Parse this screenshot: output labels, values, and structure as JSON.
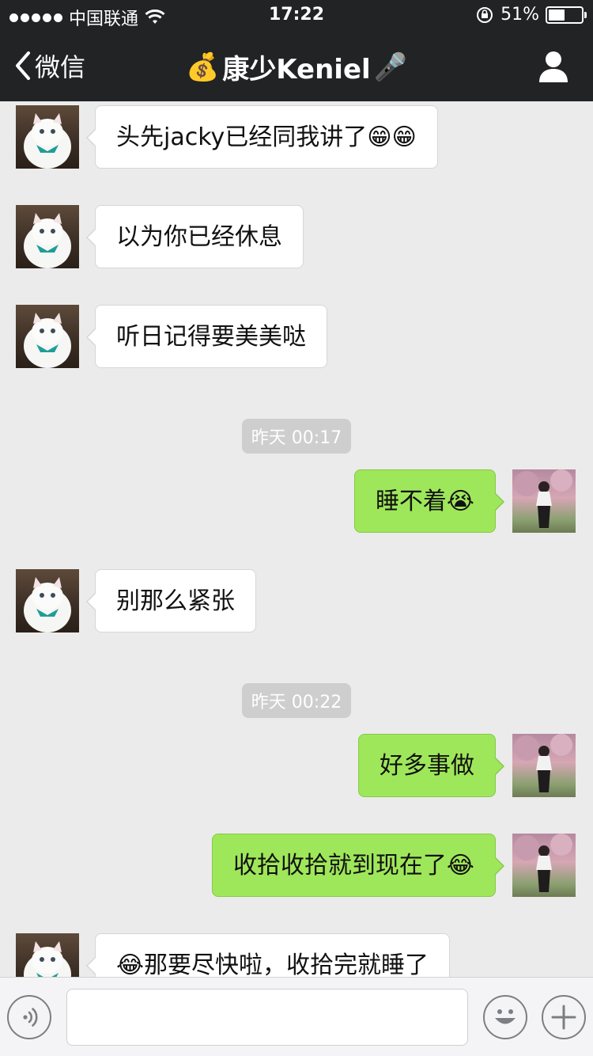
{
  "status_bar": {
    "carrier": "中国联通",
    "time": "17:22",
    "battery_text": "51%",
    "battery_level": 0.51,
    "signal_dots": 5,
    "icons": [
      "signal-dots-icon",
      "wifi-icon",
      "rotation-lock-icon",
      "battery-icon"
    ]
  },
  "nav": {
    "back_label": "微信",
    "title": "康少Keniel",
    "title_prefix_emoji": "💰",
    "title_suffix_emoji": "🎤",
    "profile_icon": "person-icon"
  },
  "messages": [
    {
      "side": "in",
      "text": "头先jacky已经同我讲了😁😁",
      "avatar": "cat-avatar"
    },
    {
      "side": "in",
      "text": "以为你已经休息",
      "avatar": "cat-avatar"
    },
    {
      "side": "in",
      "text": "听日记得要美美哒",
      "avatar": "cat-avatar"
    },
    {
      "side": "time",
      "text": "昨天 00:17"
    },
    {
      "side": "out",
      "text": "睡不着😭",
      "avatar": "girl-avatar"
    },
    {
      "side": "in",
      "text": "别那么紧张",
      "avatar": "cat-avatar"
    },
    {
      "side": "time",
      "text": "昨天 00:22"
    },
    {
      "side": "out",
      "text": "好多事做",
      "avatar": "girl-avatar"
    },
    {
      "side": "out",
      "text": "收拾收拾就到现在了😂",
      "avatar": "girl-avatar"
    },
    {
      "side": "in",
      "text": "😂那要尽快啦，收拾完就睡了",
      "avatar": "cat-avatar"
    }
  ],
  "input_bar": {
    "icons": [
      "voice-icon",
      "emoji-icon",
      "plus-icon"
    ],
    "text_value": ""
  },
  "colors": {
    "bar_bg": "#222325",
    "chat_bg": "#ebebeb",
    "incoming_bubble": "#ffffff",
    "outgoing_bubble": "#9fe75a",
    "timestamp_bg": "#cecece"
  }
}
